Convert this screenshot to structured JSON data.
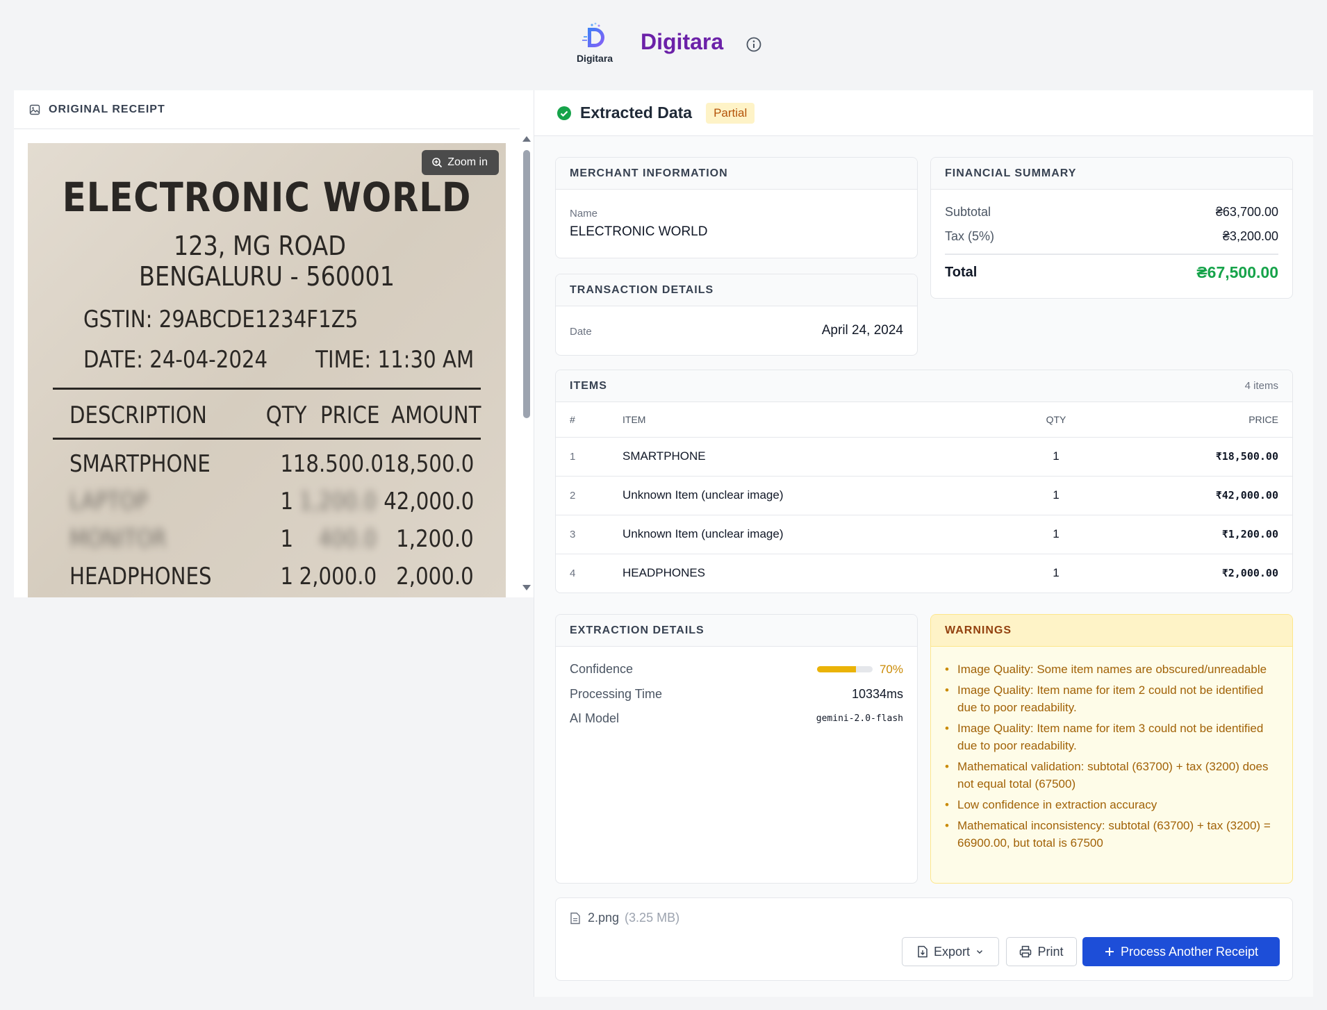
{
  "app": {
    "logo_sub": "Digitara",
    "brand": "Digitara"
  },
  "receipt_panel": {
    "title": "ORIGINAL RECEIPT",
    "zoom_label": "Zoom in",
    "image": {
      "store": "ELECTRONIC WORLD",
      "address1": "123, MG ROAD",
      "address2": "BENGALURU - 560001",
      "gstin": "GSTIN: 29ABCDE1234F1Z5",
      "date": "DATE: 24-04-2024",
      "time": "TIME: 11:30 AM",
      "headers": [
        "DESCRIPTION",
        "QTY",
        "PRICE",
        "AMOUNT"
      ],
      "rows": [
        {
          "desc": "SMARTPHONE",
          "qty": "1",
          "price": "18.500.0",
          "amount": "18,500.0"
        },
        {
          "desc": "LAPTOP",
          "qty": "1",
          "price": "1,200.0",
          "amount": "42,000.0"
        },
        {
          "desc": "MONITOR",
          "qty": "1",
          "price": "400.0",
          "amount": "1,200.0"
        },
        {
          "desc": "HEADPHONES",
          "qty": "1",
          "price": "2,000.0",
          "amount": "2,000.0"
        }
      ]
    }
  },
  "extracted": {
    "title": "Extracted Data",
    "status": "Partial",
    "merchant": {
      "heading": "MERCHANT INFORMATION",
      "name_label": "Name",
      "name": "ELECTRONIC WORLD"
    },
    "transaction": {
      "heading": "TRANSACTION DETAILS",
      "date_label": "Date",
      "date": "April 24, 2024"
    },
    "financial": {
      "heading": "FINANCIAL SUMMARY",
      "subtotal_label": "Subtotal",
      "subtotal": "₴63,700.00",
      "tax_label": "Tax (5%)",
      "tax": "₴3,200.00",
      "total_label": "Total",
      "total": "₴67,500.00"
    },
    "items": {
      "heading": "ITEMS",
      "count": "4 items",
      "columns": [
        "#",
        "ITEM",
        "QTY",
        "PRICE"
      ],
      "rows": [
        {
          "n": "1",
          "name": "SMARTPHONE",
          "qty": "1",
          "price": "₹18,500.00"
        },
        {
          "n": "2",
          "name": "Unknown Item (unclear image)",
          "qty": "1",
          "price": "₹42,000.00"
        },
        {
          "n": "3",
          "name": "Unknown Item (unclear image)",
          "qty": "1",
          "price": "₹1,200.00"
        },
        {
          "n": "4",
          "name": "HEADPHONES",
          "qty": "1",
          "price": "₹2,000.00"
        }
      ]
    },
    "details": {
      "heading": "EXTRACTION DETAILS",
      "confidence_label": "Confidence",
      "confidence": "70%",
      "confidence_value": 0.7,
      "time_label": "Processing Time",
      "time": "10334ms",
      "model_label": "AI Model",
      "model": "gemini-2.0-flash"
    },
    "warnings": {
      "heading": "WARNINGS",
      "items": [
        "Image Quality: Some item names are obscured/unreadable",
        "Image Quality: Item name for item 2 could not be identified due to poor readability.",
        "Image Quality: Item name for item 3 could not be identified due to poor readability.",
        "Mathematical validation: subtotal (63700) + tax (3200) does not equal total (67500)",
        "Low confidence in extraction accuracy",
        "Mathematical inconsistency: subtotal (63700) + tax (3200) = 66900.00, but total is 67500"
      ]
    },
    "file": {
      "name": "2.png",
      "size": "(3.25 MB)"
    },
    "actions": {
      "export": "Export",
      "print": "Print",
      "process": "Process Another Receipt"
    }
  },
  "colors": {
    "brand": "#6b21a8",
    "primary": "#1d4ed8",
    "success": "#16a34a",
    "warning": "#a16207"
  }
}
